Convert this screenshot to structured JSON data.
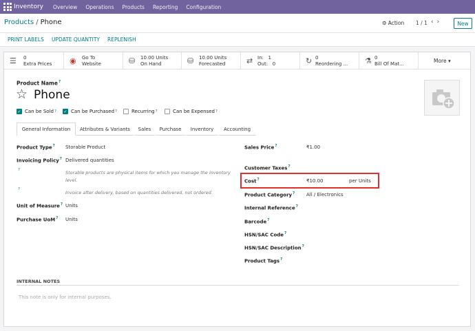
{
  "navbar": {
    "app": "Inventory",
    "menu": [
      "Overview",
      "Operations",
      "Products",
      "Reporting",
      "Configuration"
    ]
  },
  "breadcrumb": {
    "parent": "Products",
    "separator": "/",
    "current": "Phone"
  },
  "control": {
    "action": "Action",
    "pager": "1 / 1",
    "new": "New"
  },
  "buttons": {
    "print_labels": "PRINT LABELS",
    "update_quantity": "UPDATE QUANTITY",
    "replenish": "REPLENISH"
  },
  "smart": {
    "extra_prices": {
      "value": "0",
      "label": "Extra Prices"
    },
    "website": {
      "line1": "Go To",
      "line2": "Website"
    },
    "on_hand": {
      "value": "10.00 Units",
      "label": "On Hand"
    },
    "forecasted": {
      "value": "10.00 Units",
      "label": "Forecasted"
    },
    "inout": {
      "in_label": "In:",
      "in_value": "1",
      "out_label": "Out:",
      "out_value": "0"
    },
    "reordering": {
      "value": "0",
      "label": "Reordering ..."
    },
    "bom": {
      "value": "0",
      "label": "Bill Of Mat..."
    },
    "more": "More"
  },
  "product": {
    "name_label": "Product Name",
    "name": "Phone",
    "can_be_sold": "Can be Sold",
    "can_be_purchased": "Can be Purchased",
    "recurring": "Recurring",
    "can_be_expensed": "Can be Expensed"
  },
  "tabs": [
    "General Information",
    "Attributes & Variants",
    "Sales",
    "Purchase",
    "Inventory",
    "Accounting"
  ],
  "left": {
    "product_type_label": "Product Type",
    "product_type": "Storable Product",
    "invoicing_policy_label": "Invoicing Policy",
    "invoicing_policy": "Delivered quantities",
    "help1": "Storable products are physical items for which you manage the inventory level.",
    "help2": "Invoice after delivery, based on quantities delivered, not ordered.",
    "uom_label": "Unit of Measure",
    "uom": "Units",
    "purchase_uom_label": "Purchase UoM",
    "purchase_uom": "Units"
  },
  "right": {
    "sales_price_label": "Sales Price",
    "sales_price": "₹1.00",
    "customer_taxes_label": "Customer Taxes",
    "cost_label": "Cost",
    "cost": "₹10.00",
    "cost_unit": "per Units",
    "category_label": "Product Category",
    "category": "All / Electronics",
    "internal_ref_label": "Internal Reference",
    "barcode_label": "Barcode",
    "hsn_code_label": "HSN/SAC Code",
    "hsn_desc_label": "HSN/SAC Description",
    "tags_label": "Product Tags"
  },
  "notes": {
    "label": "INTERNAL NOTES",
    "placeholder": "This note is only for internal purposes."
  },
  "colors": {
    "navbar": "#71639e",
    "accent": "#017e84",
    "highlight": "#e32e2e"
  }
}
